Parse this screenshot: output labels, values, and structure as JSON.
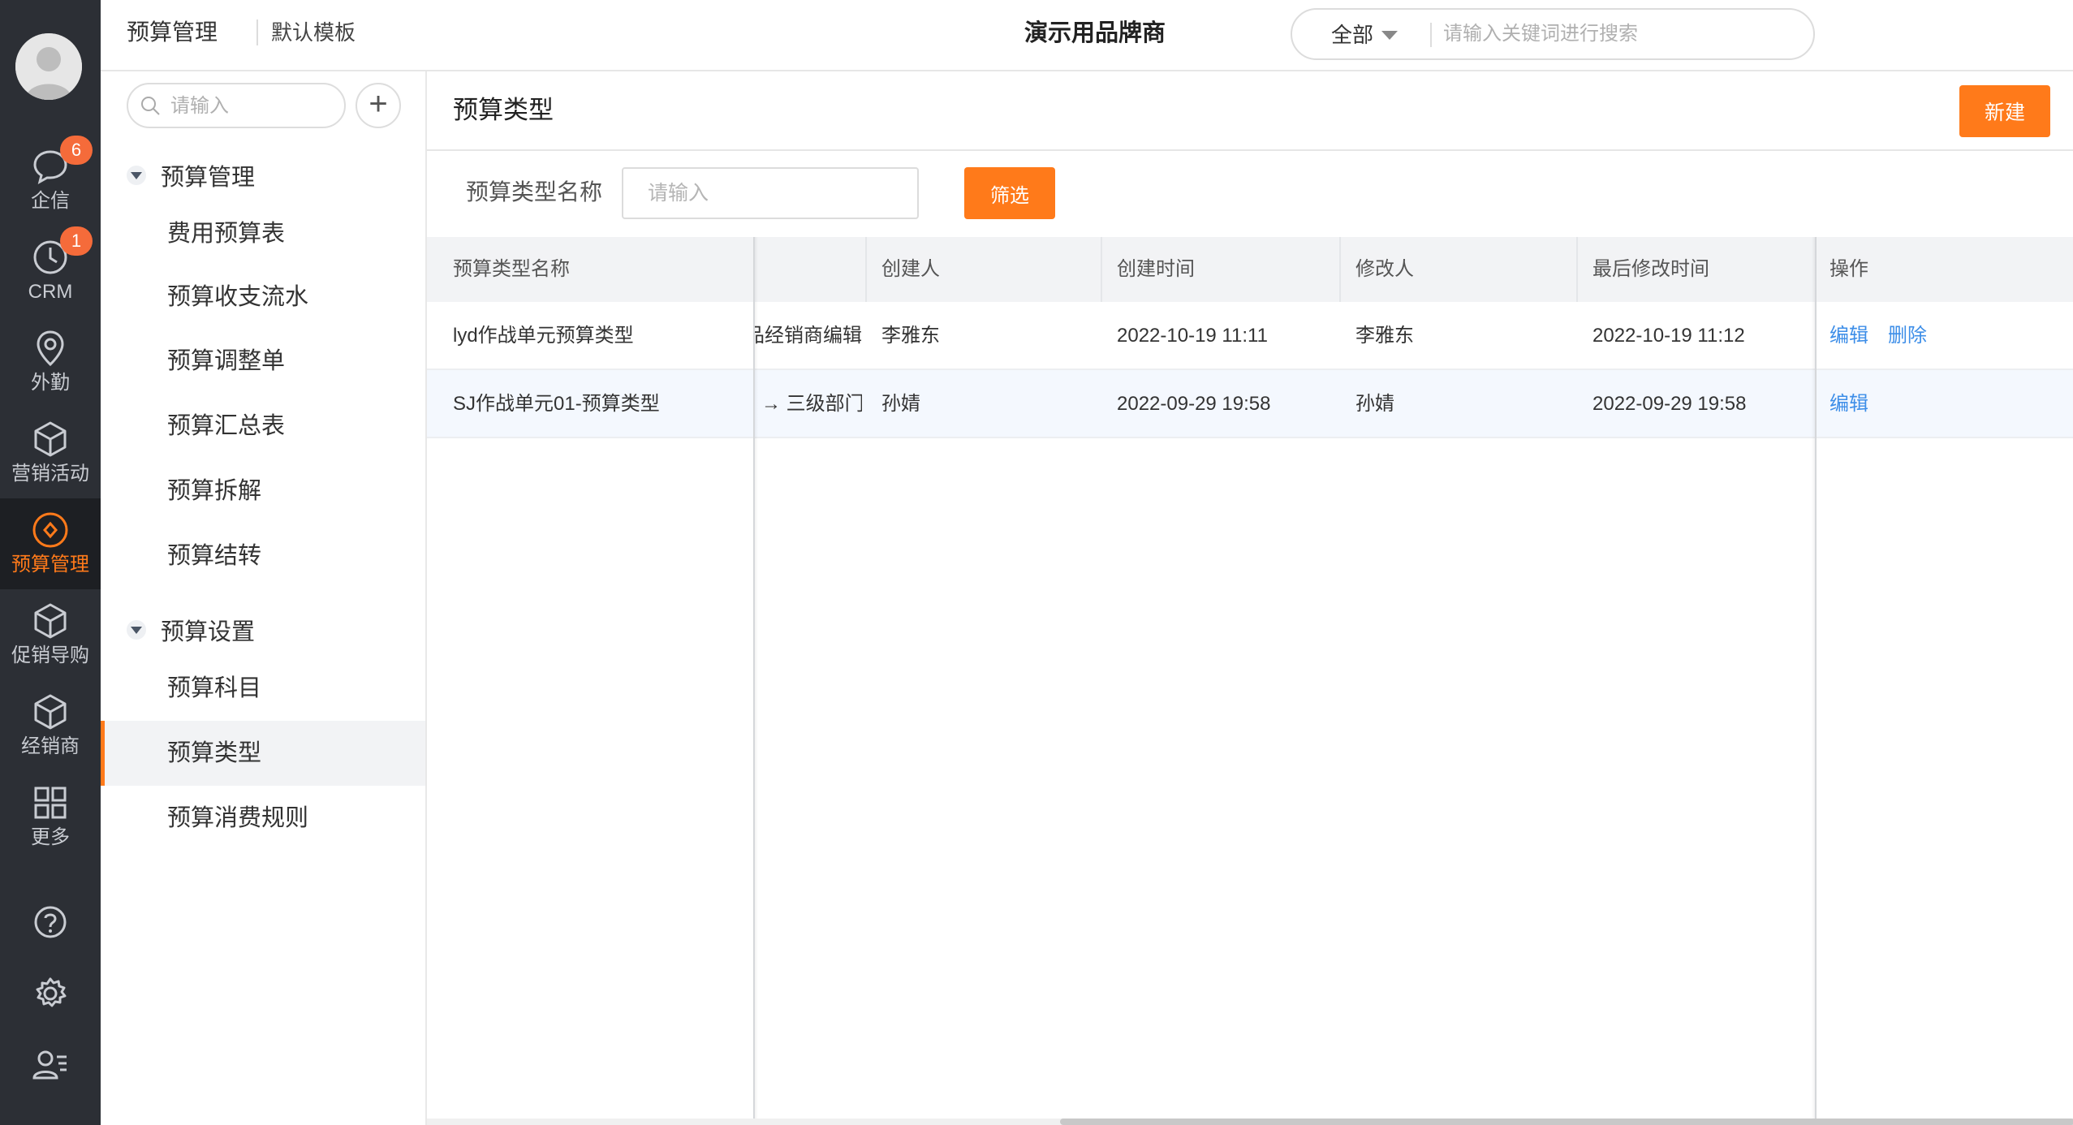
{
  "rail": {
    "items": [
      {
        "label": "企信",
        "icon": "chat-icon",
        "badge": "6"
      },
      {
        "label": "CRM",
        "icon": "clock-icon",
        "badge": "1"
      },
      {
        "label": "外勤",
        "icon": "location-pin-icon"
      },
      {
        "label": "营销活动",
        "icon": "cube-icon"
      },
      {
        "label": "预算管理",
        "icon": "budget-icon",
        "active": true
      },
      {
        "label": "促销导购",
        "icon": "cube-icon"
      },
      {
        "label": "经销商",
        "icon": "cube-icon"
      },
      {
        "label": "更多",
        "icon": "grid-icon"
      }
    ],
    "utilities": [
      "help-icon",
      "settings-icon",
      "user-manage-icon"
    ]
  },
  "header": {
    "breadcrumb_app": "预算管理",
    "breadcrumb_template": "默认模板",
    "company": "演示用品牌商",
    "search_scope": "全部",
    "search_placeholder": "请输入关键词进行搜索"
  },
  "subnav": {
    "search_placeholder": "请输入",
    "add_label": "+",
    "groups": [
      {
        "label": "预算管理",
        "items": [
          "费用预算表",
          "预算收支流水",
          "预算调整单",
          "预算汇总表",
          "预算拆解",
          "预算结转"
        ]
      },
      {
        "label": "预算设置",
        "items": [
          "预算科目",
          "预算类型",
          "预算消费规则"
        ]
      }
    ],
    "active_item": "预算类型"
  },
  "main": {
    "title": "预算类型",
    "new_button": "新建",
    "filter_label": "预算类型名称",
    "filter_placeholder": "请输入",
    "filter_button": "筛选"
  },
  "table": {
    "columns": [
      "预算类型名称",
      "创建人",
      "创建时间",
      "修改人",
      "最后修改时间",
      "操作"
    ],
    "rows": [
      {
        "name": "lyd作战单元预算类型",
        "scope": "产品经销商编辑",
        "creator": "李雅东",
        "created": "2022-10-19 11:11",
        "modifier": "李雅东",
        "modified": "2022-10-19 11:12",
        "actions": [
          "编辑",
          "删除"
        ]
      },
      {
        "name": "SJ作战单元01-预算类型",
        "scope": "→ 三级部门",
        "creator": "孙婧",
        "created": "2022-09-29 19:58",
        "modifier": "孙婧",
        "modified": "2022-09-29 19:58",
        "actions": [
          "编辑"
        ]
      }
    ]
  },
  "colors": {
    "accent": "#ff7a1a",
    "rail_bg": "#2c2f35",
    "link": "#3d8ee8",
    "badge": "#f56b3a"
  }
}
